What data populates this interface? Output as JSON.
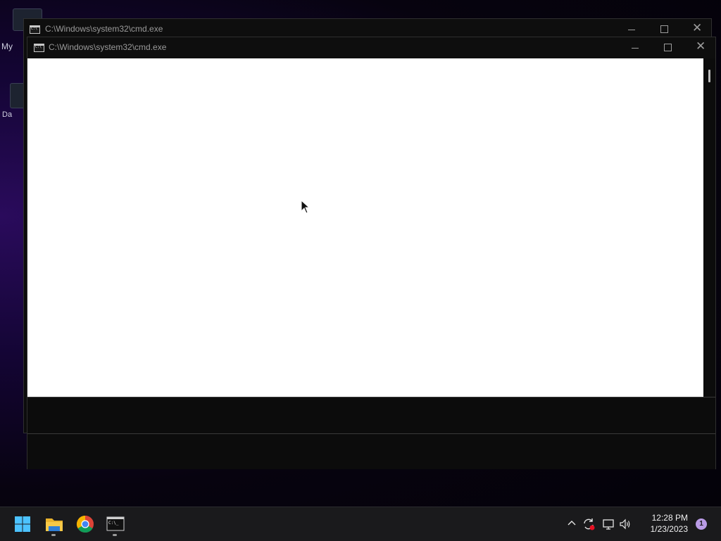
{
  "desktop": {
    "icon_labels": [
      "My",
      "Da"
    ]
  },
  "windows": [
    {
      "title": "C:\\Windows\\system32\\cmd.exe",
      "icon": "cmd-console-icon",
      "controls": [
        "minimize",
        "maximize",
        "close"
      ]
    },
    {
      "title": "C:\\Windows\\system32\\cmd.exe",
      "icon": "cmd-console-icon",
      "controls": [
        "minimize",
        "maximize",
        "close"
      ],
      "client_color": "#ffffff"
    }
  ],
  "taskbar": {
    "apps": [
      {
        "name": "Start",
        "icon": "windows-logo-icon"
      },
      {
        "name": "File Explorer",
        "icon": "folder-icon",
        "running": true
      },
      {
        "name": "Google Chrome",
        "icon": "chrome-icon",
        "running": false
      },
      {
        "name": "Command Prompt",
        "icon": "cmd-console-icon",
        "running": true
      }
    ],
    "tray": {
      "icons": [
        "chevron-up-icon",
        "sync-icon",
        "network-icon",
        "volume-icon"
      ],
      "time": "12:28 PM",
      "date": "1/23/2023",
      "notification_count": "1"
    }
  }
}
